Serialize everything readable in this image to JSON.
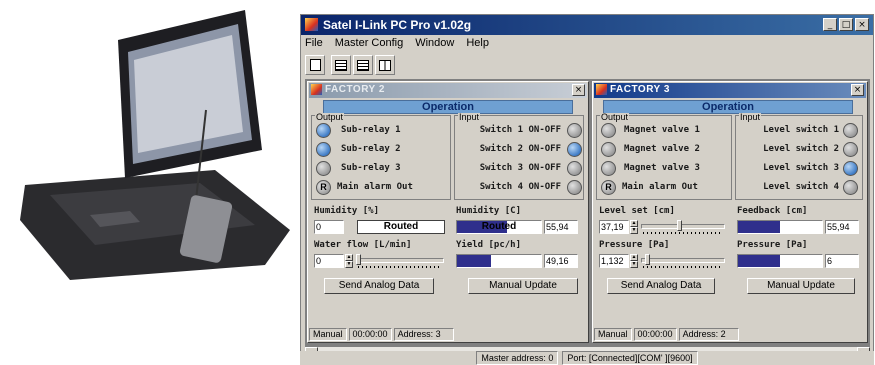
{
  "app": {
    "title": "Satel I-Link PC Pro v1.02g"
  },
  "window_buttons": [
    "_",
    "□",
    "×"
  ],
  "menu": [
    "File",
    "Master Config",
    "Window",
    "Help"
  ],
  "toolbar": {
    "icons": [
      "new-document-icon",
      "tile-horizontal-icon",
      "tile-vertical-icon"
    ]
  },
  "factory2": {
    "title": "FACTORY 2",
    "operation": "Operation",
    "output_label": "Output",
    "input_label": "Input",
    "outputs": [
      {
        "label": "Sub-relay 1",
        "state": "on"
      },
      {
        "label": "Sub-relay 2",
        "state": "on"
      },
      {
        "label": "Sub-relay 3",
        "state": "off"
      },
      {
        "label": "Main alarm Out",
        "state": "R",
        "led_text": "R"
      }
    ],
    "inputs": [
      {
        "label": "Switch 1 ON-OFF",
        "state": "off"
      },
      {
        "label": "Switch 2 ON-OFF",
        "state": "on"
      },
      {
        "label": "Switch 3 ON-OFF",
        "state": "off"
      },
      {
        "label": "Switch 4 ON-OFF",
        "state": "off"
      }
    ],
    "humidity_pct": {
      "label": "Humidity [%]",
      "value": "0",
      "status": "Routed"
    },
    "humidity_c": {
      "label": "Humidity [C]",
      "bar_text": "Routed",
      "bar_fill": 0.6,
      "value": "55,94"
    },
    "water_flow": {
      "label": "Water flow [L/min]",
      "value": "0",
      "slider": 0.0
    },
    "yield": {
      "label": "Yield [pc/h]",
      "bar_fill": 0.4,
      "value": "49,16"
    },
    "send_button": "Send Analog Data",
    "update_button": "Manual Update",
    "status": [
      "Manual",
      "00:00:00",
      "Address: 3"
    ]
  },
  "factory3": {
    "title": "FACTORY 3",
    "operation": "Operation",
    "output_label": "Output",
    "input_label": "Input",
    "outputs": [
      {
        "label": "Magnet valve 1",
        "state": "off"
      },
      {
        "label": "Magnet valve 2",
        "state": "off"
      },
      {
        "label": "Magnet valve 3",
        "state": "off"
      },
      {
        "label": "Main alarm Out",
        "state": "R",
        "led_text": "R"
      }
    ],
    "inputs": [
      {
        "label": "Level switch 1",
        "state": "off"
      },
      {
        "label": "Level switch 2",
        "state": "off"
      },
      {
        "label": "Level switch 3",
        "state": "on"
      },
      {
        "label": "Level switch 4",
        "state": "off"
      }
    ],
    "level_set": {
      "label": "Level set [cm]",
      "value": "37,19",
      "slider": 0.45
    },
    "feedback": {
      "label": "Feedback [cm]",
      "bar_fill": 0.5,
      "value": "55,94"
    },
    "pressure_out": {
      "label": "Pressure [Pa]",
      "value": "1,132",
      "slider": 0.05
    },
    "pressure_in": {
      "label": "Pressure [Pa]",
      "bar_fill": 0.5,
      "value": "6"
    },
    "send_button": "Send Analog Data",
    "update_button": "Manual Update",
    "status": [
      "Manual",
      "00:00:00",
      "Address: 2"
    ]
  },
  "statusbar": {
    "master": "Master address: 0",
    "port": "Port: [Connected][COM' ][9600]"
  },
  "colors": {
    "title_active": "#0a246a",
    "operation_header": "#6fa0d2",
    "led_on": "#3f7cc6",
    "bar_fill": "#2f2f8c"
  }
}
